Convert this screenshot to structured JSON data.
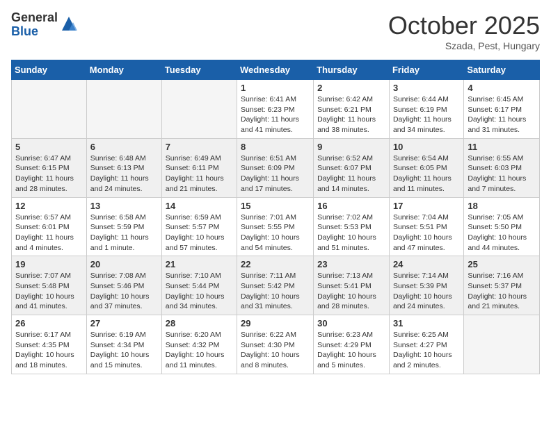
{
  "logo": {
    "general": "General",
    "blue": "Blue"
  },
  "header": {
    "month": "October 2025",
    "location": "Szada, Pest, Hungary"
  },
  "days_of_week": [
    "Sunday",
    "Monday",
    "Tuesday",
    "Wednesday",
    "Thursday",
    "Friday",
    "Saturday"
  ],
  "weeks": [
    [
      {
        "day": "",
        "info": ""
      },
      {
        "day": "",
        "info": ""
      },
      {
        "day": "",
        "info": ""
      },
      {
        "day": "1",
        "info": "Sunrise: 6:41 AM\nSunset: 6:23 PM\nDaylight: 11 hours and 41 minutes."
      },
      {
        "day": "2",
        "info": "Sunrise: 6:42 AM\nSunset: 6:21 PM\nDaylight: 11 hours and 38 minutes."
      },
      {
        "day": "3",
        "info": "Sunrise: 6:44 AM\nSunset: 6:19 PM\nDaylight: 11 hours and 34 minutes."
      },
      {
        "day": "4",
        "info": "Sunrise: 6:45 AM\nSunset: 6:17 PM\nDaylight: 11 hours and 31 minutes."
      }
    ],
    [
      {
        "day": "5",
        "info": "Sunrise: 6:47 AM\nSunset: 6:15 PM\nDaylight: 11 hours and 28 minutes."
      },
      {
        "day": "6",
        "info": "Sunrise: 6:48 AM\nSunset: 6:13 PM\nDaylight: 11 hours and 24 minutes."
      },
      {
        "day": "7",
        "info": "Sunrise: 6:49 AM\nSunset: 6:11 PM\nDaylight: 11 hours and 21 minutes."
      },
      {
        "day": "8",
        "info": "Sunrise: 6:51 AM\nSunset: 6:09 PM\nDaylight: 11 hours and 17 minutes."
      },
      {
        "day": "9",
        "info": "Sunrise: 6:52 AM\nSunset: 6:07 PM\nDaylight: 11 hours and 14 minutes."
      },
      {
        "day": "10",
        "info": "Sunrise: 6:54 AM\nSunset: 6:05 PM\nDaylight: 11 hours and 11 minutes."
      },
      {
        "day": "11",
        "info": "Sunrise: 6:55 AM\nSunset: 6:03 PM\nDaylight: 11 hours and 7 minutes."
      }
    ],
    [
      {
        "day": "12",
        "info": "Sunrise: 6:57 AM\nSunset: 6:01 PM\nDaylight: 11 hours and 4 minutes."
      },
      {
        "day": "13",
        "info": "Sunrise: 6:58 AM\nSunset: 5:59 PM\nDaylight: 11 hours and 1 minute."
      },
      {
        "day": "14",
        "info": "Sunrise: 6:59 AM\nSunset: 5:57 PM\nDaylight: 10 hours and 57 minutes."
      },
      {
        "day": "15",
        "info": "Sunrise: 7:01 AM\nSunset: 5:55 PM\nDaylight: 10 hours and 54 minutes."
      },
      {
        "day": "16",
        "info": "Sunrise: 7:02 AM\nSunset: 5:53 PM\nDaylight: 10 hours and 51 minutes."
      },
      {
        "day": "17",
        "info": "Sunrise: 7:04 AM\nSunset: 5:51 PM\nDaylight: 10 hours and 47 minutes."
      },
      {
        "day": "18",
        "info": "Sunrise: 7:05 AM\nSunset: 5:50 PM\nDaylight: 10 hours and 44 minutes."
      }
    ],
    [
      {
        "day": "19",
        "info": "Sunrise: 7:07 AM\nSunset: 5:48 PM\nDaylight: 10 hours and 41 minutes."
      },
      {
        "day": "20",
        "info": "Sunrise: 7:08 AM\nSunset: 5:46 PM\nDaylight: 10 hours and 37 minutes."
      },
      {
        "day": "21",
        "info": "Sunrise: 7:10 AM\nSunset: 5:44 PM\nDaylight: 10 hours and 34 minutes."
      },
      {
        "day": "22",
        "info": "Sunrise: 7:11 AM\nSunset: 5:42 PM\nDaylight: 10 hours and 31 minutes."
      },
      {
        "day": "23",
        "info": "Sunrise: 7:13 AM\nSunset: 5:41 PM\nDaylight: 10 hours and 28 minutes."
      },
      {
        "day": "24",
        "info": "Sunrise: 7:14 AM\nSunset: 5:39 PM\nDaylight: 10 hours and 24 minutes."
      },
      {
        "day": "25",
        "info": "Sunrise: 7:16 AM\nSunset: 5:37 PM\nDaylight: 10 hours and 21 minutes."
      }
    ],
    [
      {
        "day": "26",
        "info": "Sunrise: 6:17 AM\nSunset: 4:35 PM\nDaylight: 10 hours and 18 minutes."
      },
      {
        "day": "27",
        "info": "Sunrise: 6:19 AM\nSunset: 4:34 PM\nDaylight: 10 hours and 15 minutes."
      },
      {
        "day": "28",
        "info": "Sunrise: 6:20 AM\nSunset: 4:32 PM\nDaylight: 10 hours and 11 minutes."
      },
      {
        "day": "29",
        "info": "Sunrise: 6:22 AM\nSunset: 4:30 PM\nDaylight: 10 hours and 8 minutes."
      },
      {
        "day": "30",
        "info": "Sunrise: 6:23 AM\nSunset: 4:29 PM\nDaylight: 10 hours and 5 minutes."
      },
      {
        "day": "31",
        "info": "Sunrise: 6:25 AM\nSunset: 4:27 PM\nDaylight: 10 hours and 2 minutes."
      },
      {
        "day": "",
        "info": ""
      }
    ]
  ]
}
